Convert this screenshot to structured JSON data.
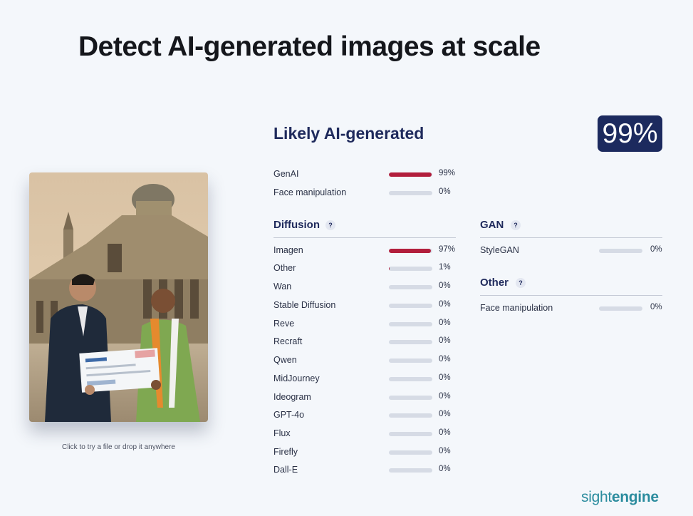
{
  "headline": "Detect AI-generated images at scale",
  "photo": {
    "caption": "Click to try a file or drop it anywhere"
  },
  "result": {
    "verdict": "Likely AI-generated",
    "score": "99%"
  },
  "summary": [
    {
      "label": "GenAI",
      "percent": "99%",
      "value": 0.99
    },
    {
      "label": "Face manipulation",
      "percent": "0%",
      "value": 0.0
    }
  ],
  "diffusion": {
    "title": "Diffusion",
    "help": "?",
    "items": [
      {
        "label": "Imagen",
        "percent": "97%",
        "value": 0.97
      },
      {
        "label": "Other",
        "percent": "1%",
        "value": 0.01
      },
      {
        "label": "Wan",
        "percent": "0%",
        "value": 0.0
      },
      {
        "label": "Stable Diffusion",
        "percent": "0%",
        "value": 0.0
      },
      {
        "label": "Reve",
        "percent": "0%",
        "value": 0.0
      },
      {
        "label": "Recraft",
        "percent": "0%",
        "value": 0.0
      },
      {
        "label": "Qwen",
        "percent": "0%",
        "value": 0.0
      },
      {
        "label": "MidJourney",
        "percent": "0%",
        "value": 0.0
      },
      {
        "label": "Ideogram",
        "percent": "0%",
        "value": 0.0
      },
      {
        "label": "GPT-4o",
        "percent": "0%",
        "value": 0.0
      },
      {
        "label": "Flux",
        "percent": "0%",
        "value": 0.0
      },
      {
        "label": "Firefly",
        "percent": "0%",
        "value": 0.0
      },
      {
        "label": "Dall-E",
        "percent": "0%",
        "value": 0.0
      }
    ]
  },
  "gan": {
    "title": "GAN",
    "help": "?",
    "items": [
      {
        "label": "StyleGAN",
        "percent": "0%",
        "value": 0.0
      }
    ]
  },
  "other": {
    "title": "Other",
    "help": "?",
    "items": [
      {
        "label": "Face manipulation",
        "percent": "0%",
        "value": 0.0
      }
    ]
  },
  "brand": {
    "part1": "sight",
    "part2": "engine"
  },
  "colors": {
    "accent": "#b21e3c",
    "navy": "#1c2a5e",
    "brand": "#2b8c9e",
    "track": "#d6dbe5"
  }
}
